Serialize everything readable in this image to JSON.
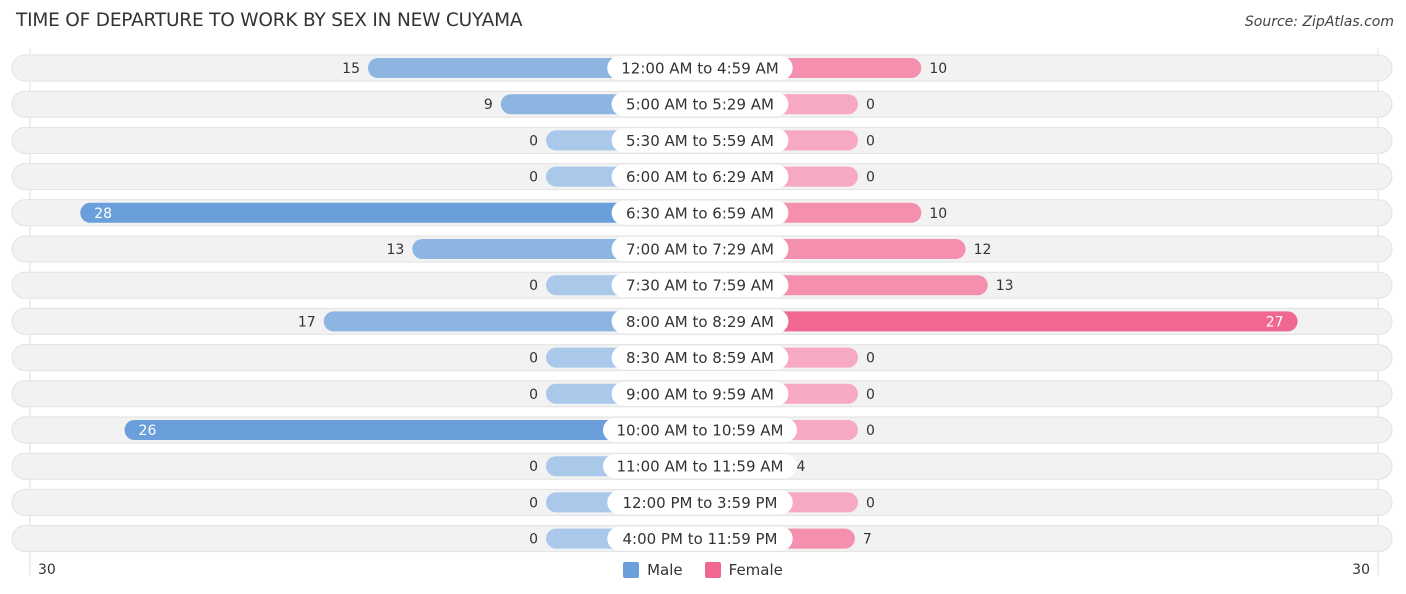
{
  "header": {
    "title": "TIME OF DEPARTURE TO WORK BY SEX IN NEW CUYAMA",
    "source": "Source: ZipAtlas.com"
  },
  "colors": {
    "male_light": "#a9c8ea",
    "male_mid": "#8db5e2",
    "male_dark": "#6a9fdb",
    "female_light": "#f6a9c0",
    "female_mid": "#f58fae",
    "female_dark": "#f06892",
    "row_bg": "#f2f2f2"
  },
  "legend": {
    "male_label": "Male",
    "female_label": "Female"
  },
  "axis": {
    "left_label": "30",
    "right_label": "30"
  },
  "chart_data": {
    "type": "bar",
    "orientation": "horizontal-diverging",
    "title": "TIME OF DEPARTURE TO WORK BY SEX IN NEW CUYAMA",
    "xlim": [
      -30,
      30
    ],
    "legend_position": "bottom-center",
    "categories": [
      "12:00 AM to 4:59 AM",
      "5:00 AM to 5:29 AM",
      "5:30 AM to 5:59 AM",
      "6:00 AM to 6:29 AM",
      "6:30 AM to 6:59 AM",
      "7:00 AM to 7:29 AM",
      "7:30 AM to 7:59 AM",
      "8:00 AM to 8:29 AM",
      "8:30 AM to 8:59 AM",
      "9:00 AM to 9:59 AM",
      "10:00 AM to 10:59 AM",
      "11:00 AM to 11:59 AM",
      "12:00 PM to 3:59 PM",
      "4:00 PM to 11:59 PM"
    ],
    "series": [
      {
        "name": "Male",
        "values": [
          15,
          9,
          0,
          0,
          28,
          13,
          0,
          17,
          0,
          0,
          26,
          0,
          0,
          0
        ]
      },
      {
        "name": "Female",
        "values": [
          10,
          0,
          0,
          0,
          10,
          12,
          13,
          27,
          0,
          0,
          0,
          4,
          0,
          7
        ]
      }
    ]
  }
}
